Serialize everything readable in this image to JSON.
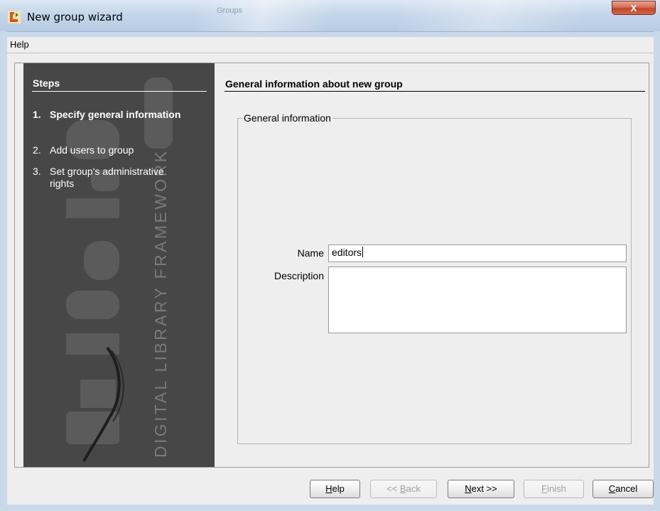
{
  "window": {
    "title": "New group wizard",
    "ghost_tab": "Groups",
    "close_label": "X"
  },
  "menu": {
    "items": [
      {
        "label": "Help"
      }
    ]
  },
  "steps": {
    "title": "Steps",
    "items": [
      {
        "num": "1.",
        "label": "Specify general information",
        "active": true
      },
      {
        "num": "2.",
        "label": "Add users to group",
        "active": false
      },
      {
        "num": "3.",
        "label": "Set group's administrative rights",
        "active": false
      }
    ],
    "watermark_text": "DIGITAL LIBRARY FRAMEWORK"
  },
  "page": {
    "title": "General information about new group",
    "group_title": "General information",
    "name_label": "Name",
    "name_value": "editors",
    "description_label": "Description",
    "description_value": ""
  },
  "buttons": {
    "help": {
      "accel": "H",
      "rest": "elp"
    },
    "back": {
      "prefix": "<< ",
      "accel": "B",
      "rest": "ack"
    },
    "next": {
      "accel": "N",
      "rest": "ext >>"
    },
    "finish": {
      "accel": "F",
      "rest": "inish"
    },
    "cancel": {
      "accel": "C",
      "rest": "ancel"
    }
  },
  "colors": {
    "steps_bg": "#474747",
    "window_chrome": "#c4d6ea",
    "close_red": "#c0462a"
  }
}
